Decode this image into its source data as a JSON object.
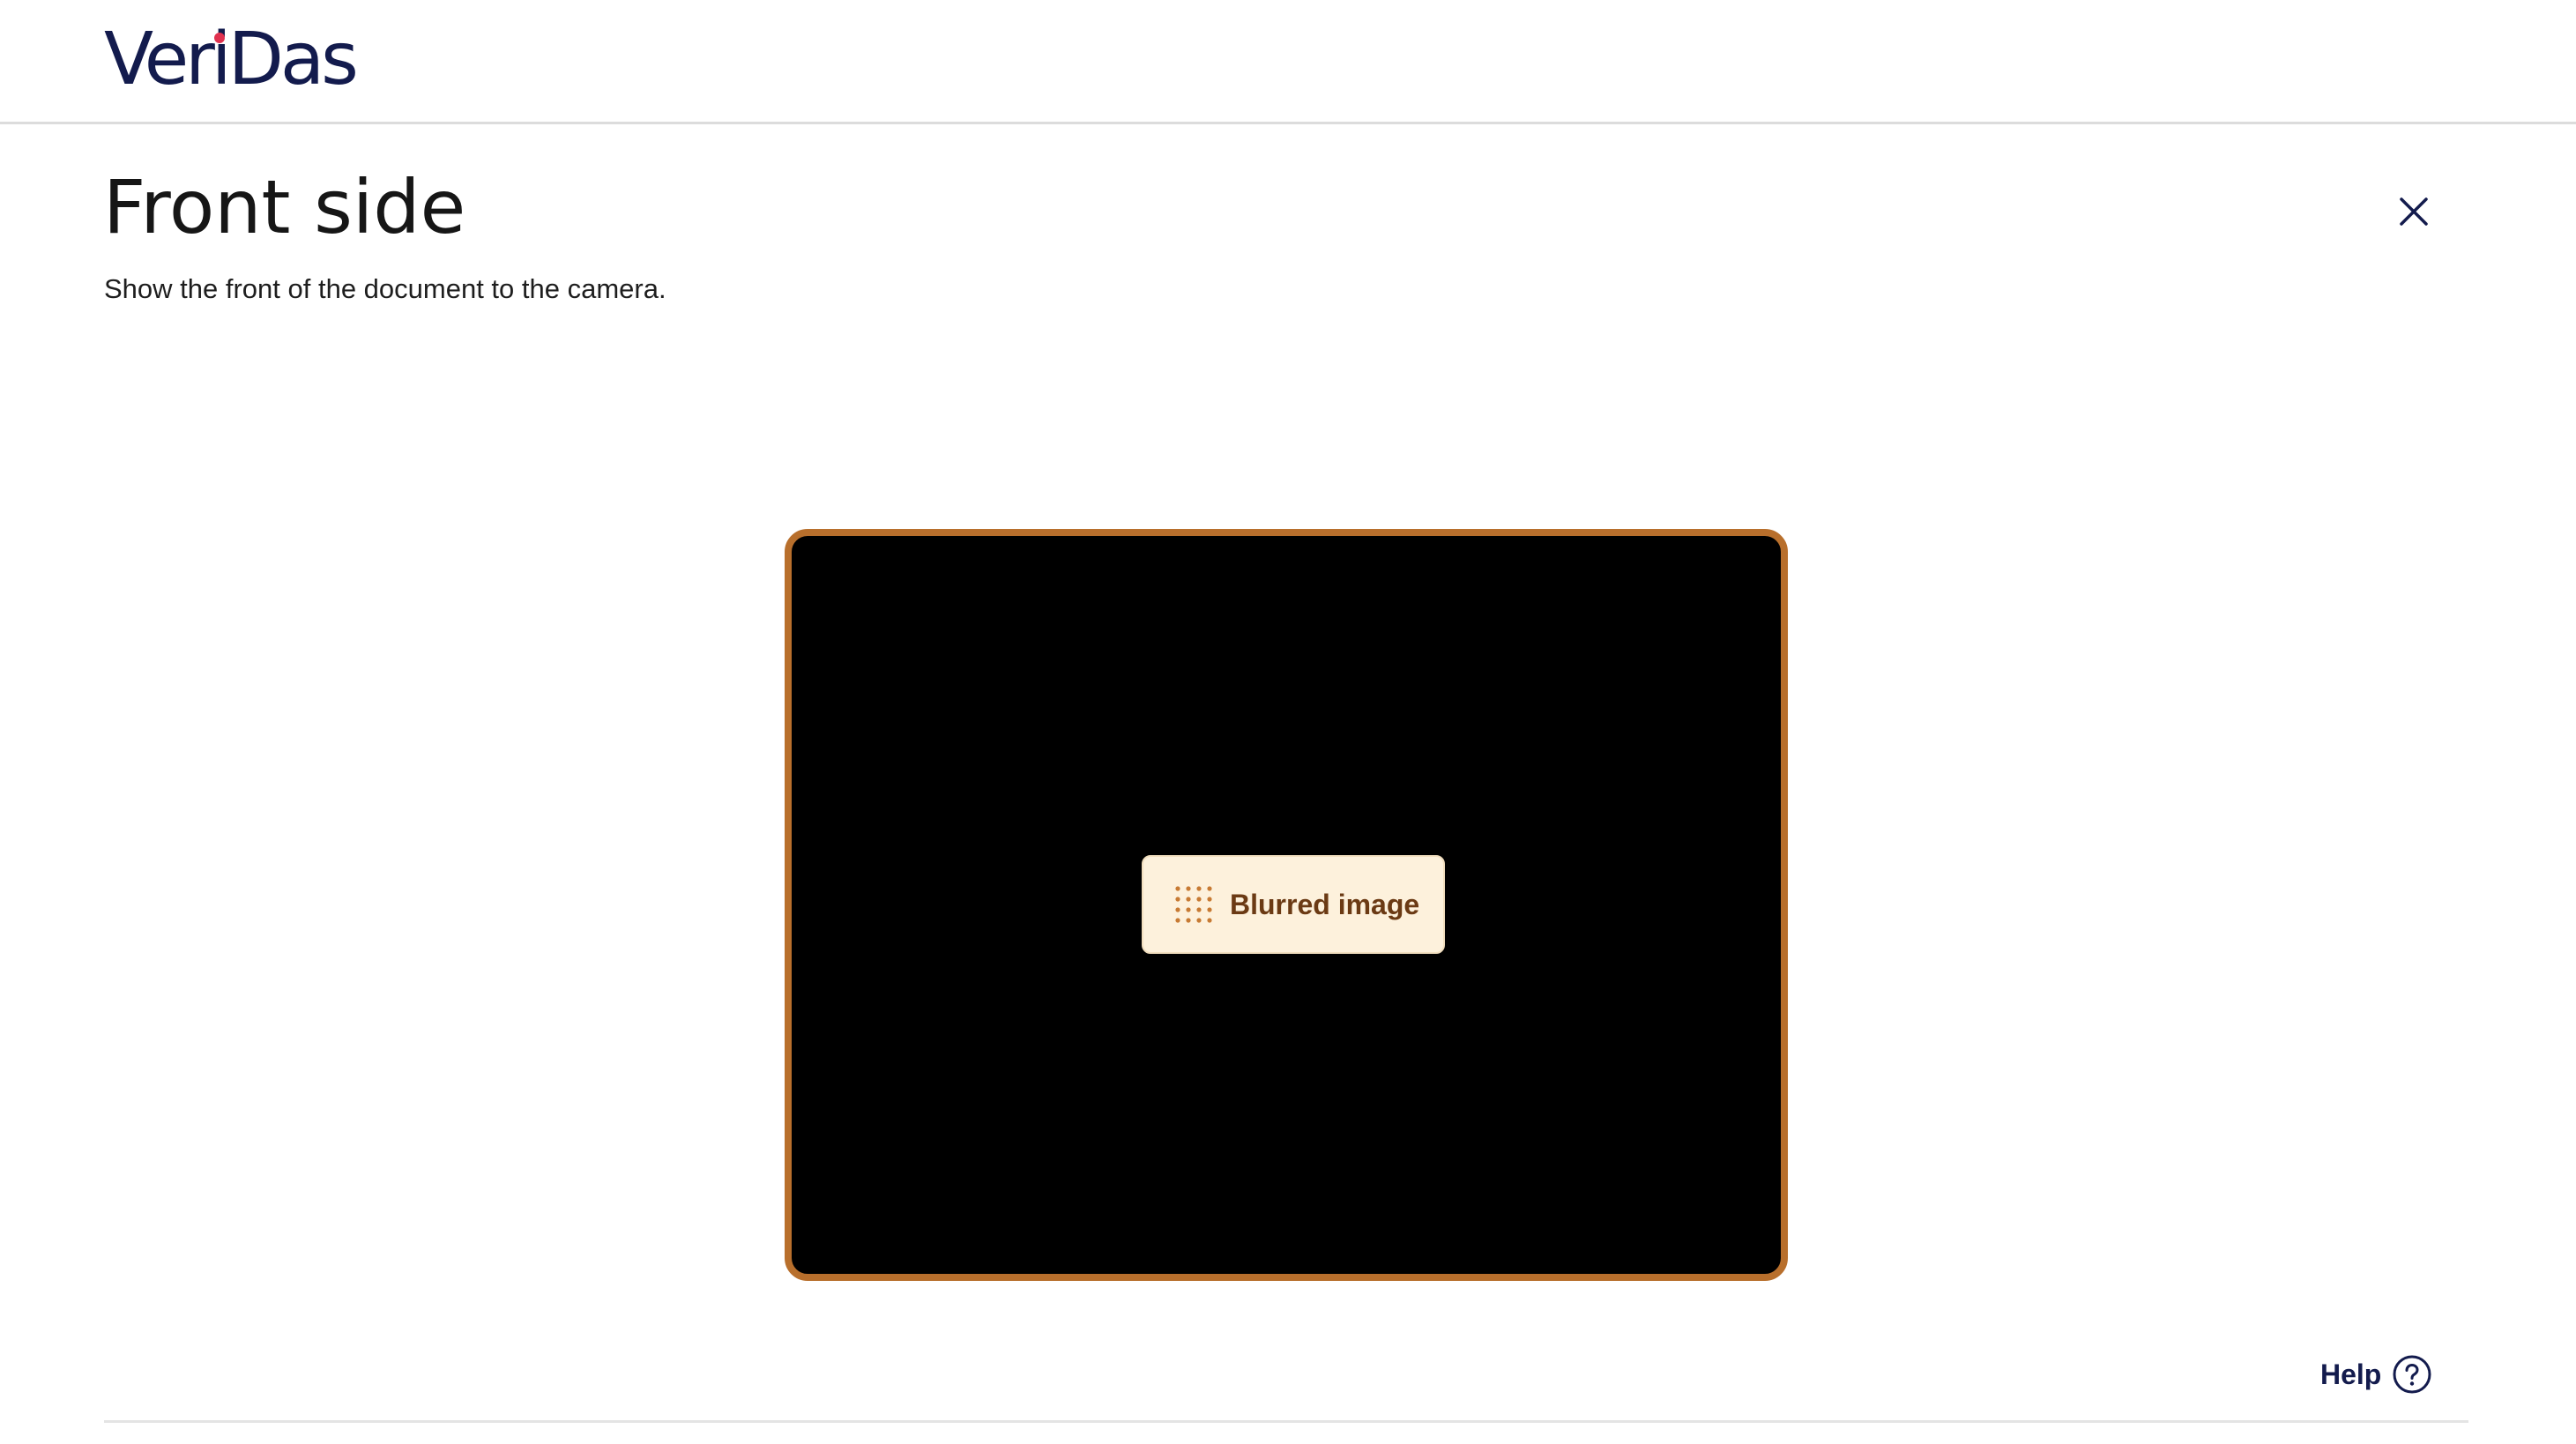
{
  "header": {
    "logo_text_before": "Ver",
    "logo_text_i": "i",
    "logo_text_after": "Das",
    "logo_accent_color": "#e0314f",
    "logo_color": "#131b4d"
  },
  "main": {
    "title": "Front side",
    "subtitle": "Show the front of the document to the camera.",
    "close_icon": "close-icon"
  },
  "camera": {
    "frame_color": "#b86f2c",
    "status_badge": {
      "icon": "dot-grid-icon",
      "label": "Blurred image",
      "background": "#fdf1dc",
      "text_color": "#6b3a14"
    }
  },
  "footer": {
    "help_label": "Help",
    "help_icon": "question-circle-icon"
  }
}
